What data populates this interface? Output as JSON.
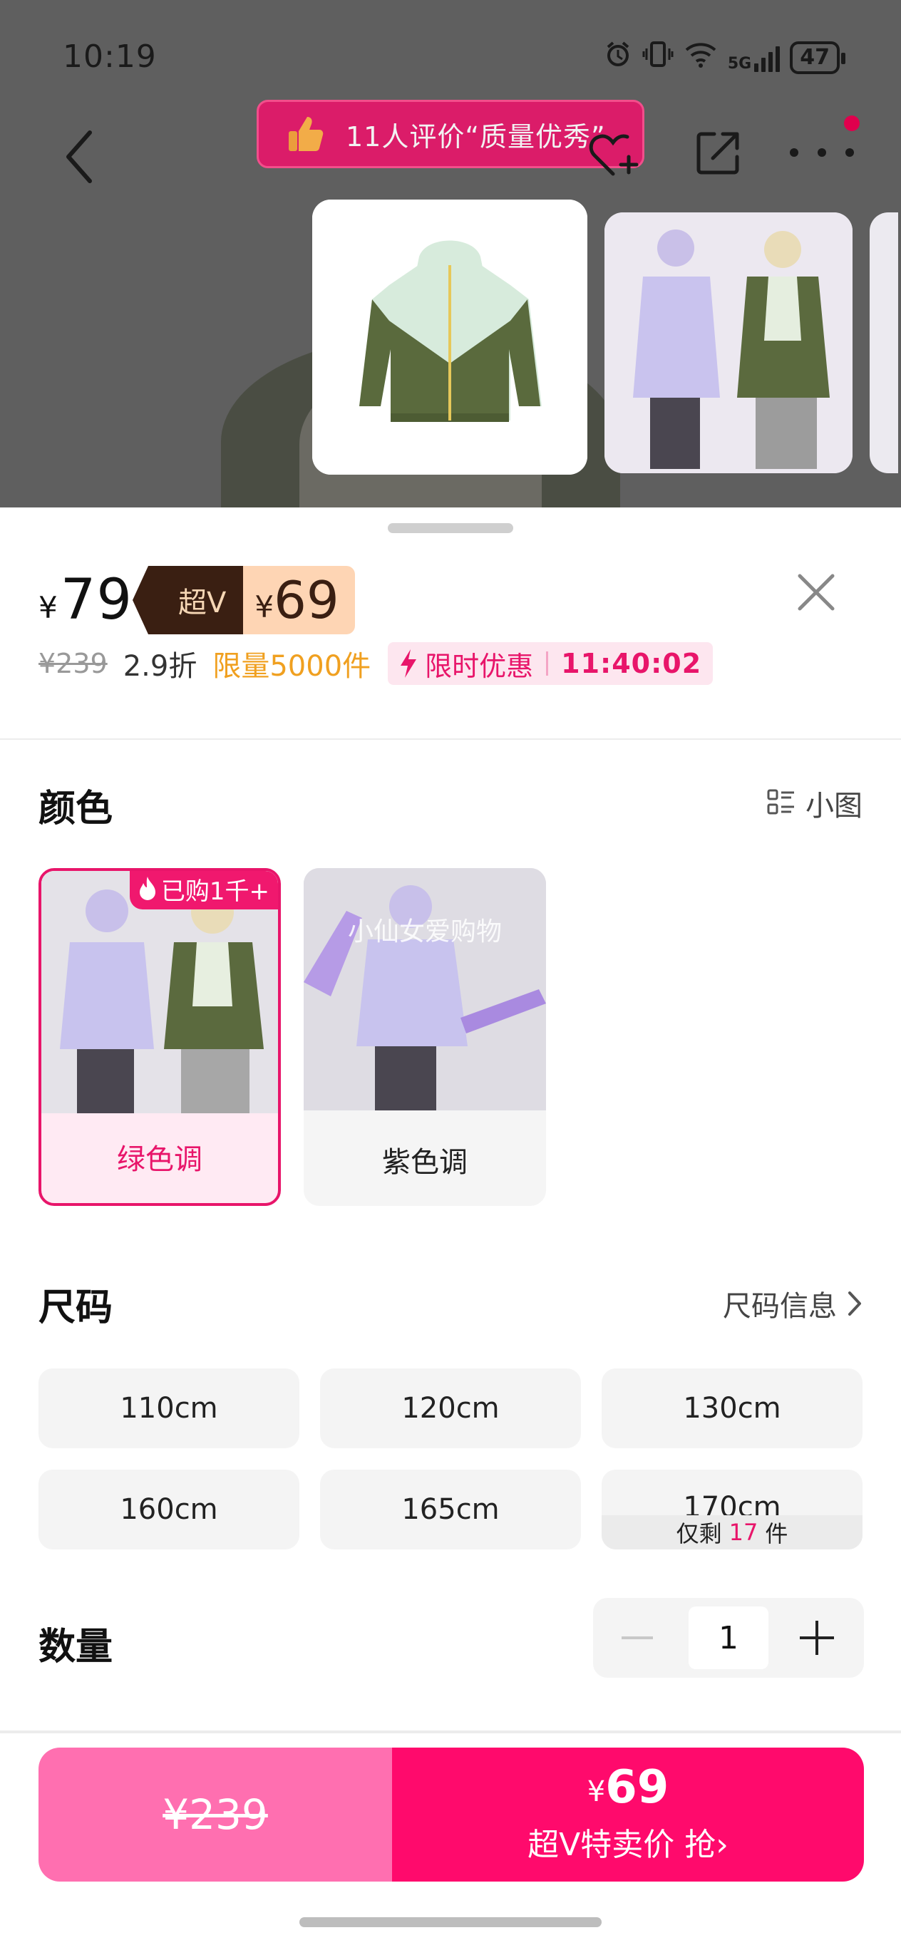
{
  "status_bar": {
    "time": "10:19",
    "network": "5G",
    "battery": "47"
  },
  "nav": {
    "review_badge": "11人评价“质量优秀”"
  },
  "price": {
    "currency": "¥",
    "current": "79",
    "vip_label": "超V",
    "vip_currency": "¥",
    "vip_price": "69",
    "original": "¥239",
    "discount": "2.9折",
    "limit": "限量5000件",
    "flash_label": "限时优惠",
    "countdown": "11:40:02"
  },
  "color_section": {
    "title": "颜色",
    "view_toggle": "小图",
    "options": [
      {
        "name": "绿色调",
        "selected": true,
        "badge": "已购1千+"
      },
      {
        "name": "紫色调",
        "selected": false,
        "watermark": "小仙女爱购物"
      }
    ]
  },
  "size_section": {
    "title": "尺码",
    "info_link": "尺码信息",
    "sizes": [
      "110cm",
      "120cm",
      "130cm",
      "160cm",
      "165cm",
      "170cm"
    ],
    "low_stock": {
      "prefix": "仅剩",
      "count": "17",
      "suffix": "件"
    }
  },
  "quantity_section": {
    "title": "数量",
    "value": "1"
  },
  "buy_bar": {
    "original_price": "¥239",
    "vip_currency": "¥",
    "vip_price": "69",
    "action": "超V特卖价 抢›"
  },
  "colors": {
    "accent": "#e8156a",
    "buy_left": "#ff6fb0",
    "buy_right": "#ff0a6c",
    "vip_dark": "#3a1f12",
    "vip_light": "#fed5b4",
    "limit": "#f0a020"
  }
}
